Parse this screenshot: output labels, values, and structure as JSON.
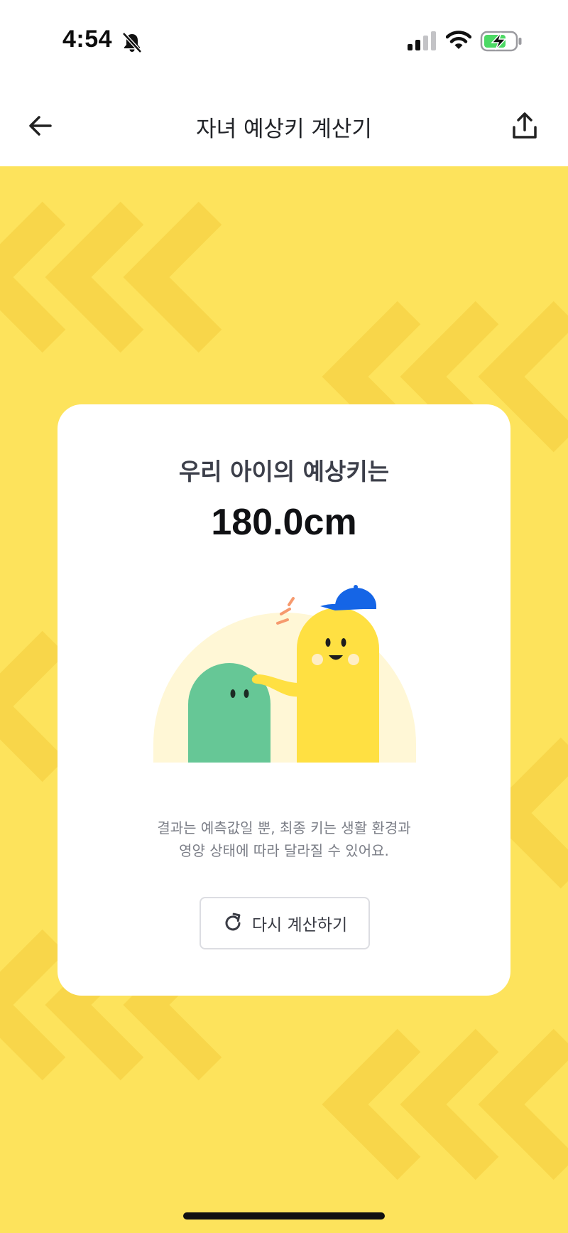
{
  "status_bar": {
    "time": "4:54",
    "icons": [
      "bell-slash-icon",
      "cellular-signal-icon",
      "wifi-icon",
      "battery-charging-icon"
    ],
    "battery_color": "#4cd964"
  },
  "header": {
    "title": "자녀 예상키 계산기",
    "back_icon": "arrow-left-icon",
    "share_icon": "share-upload-icon"
  },
  "colors": {
    "background": "#fde35c",
    "pattern": "#f8d64a",
    "card": "#ffffff",
    "character_green": "#66c796",
    "character_yellow": "#ffe042",
    "cap_blue": "#1565e6"
  },
  "card": {
    "subtitle": "우리 아이의 예상키는",
    "value": "180.0cm",
    "note_line1": "결과는 예측값일 뿐, 최종 키는 생활 환경과",
    "note_line2": "영양 상태에 따라 달라질 수 있어요.",
    "retry_label": "다시 계산하기",
    "retry_icon": "refresh-icon"
  }
}
